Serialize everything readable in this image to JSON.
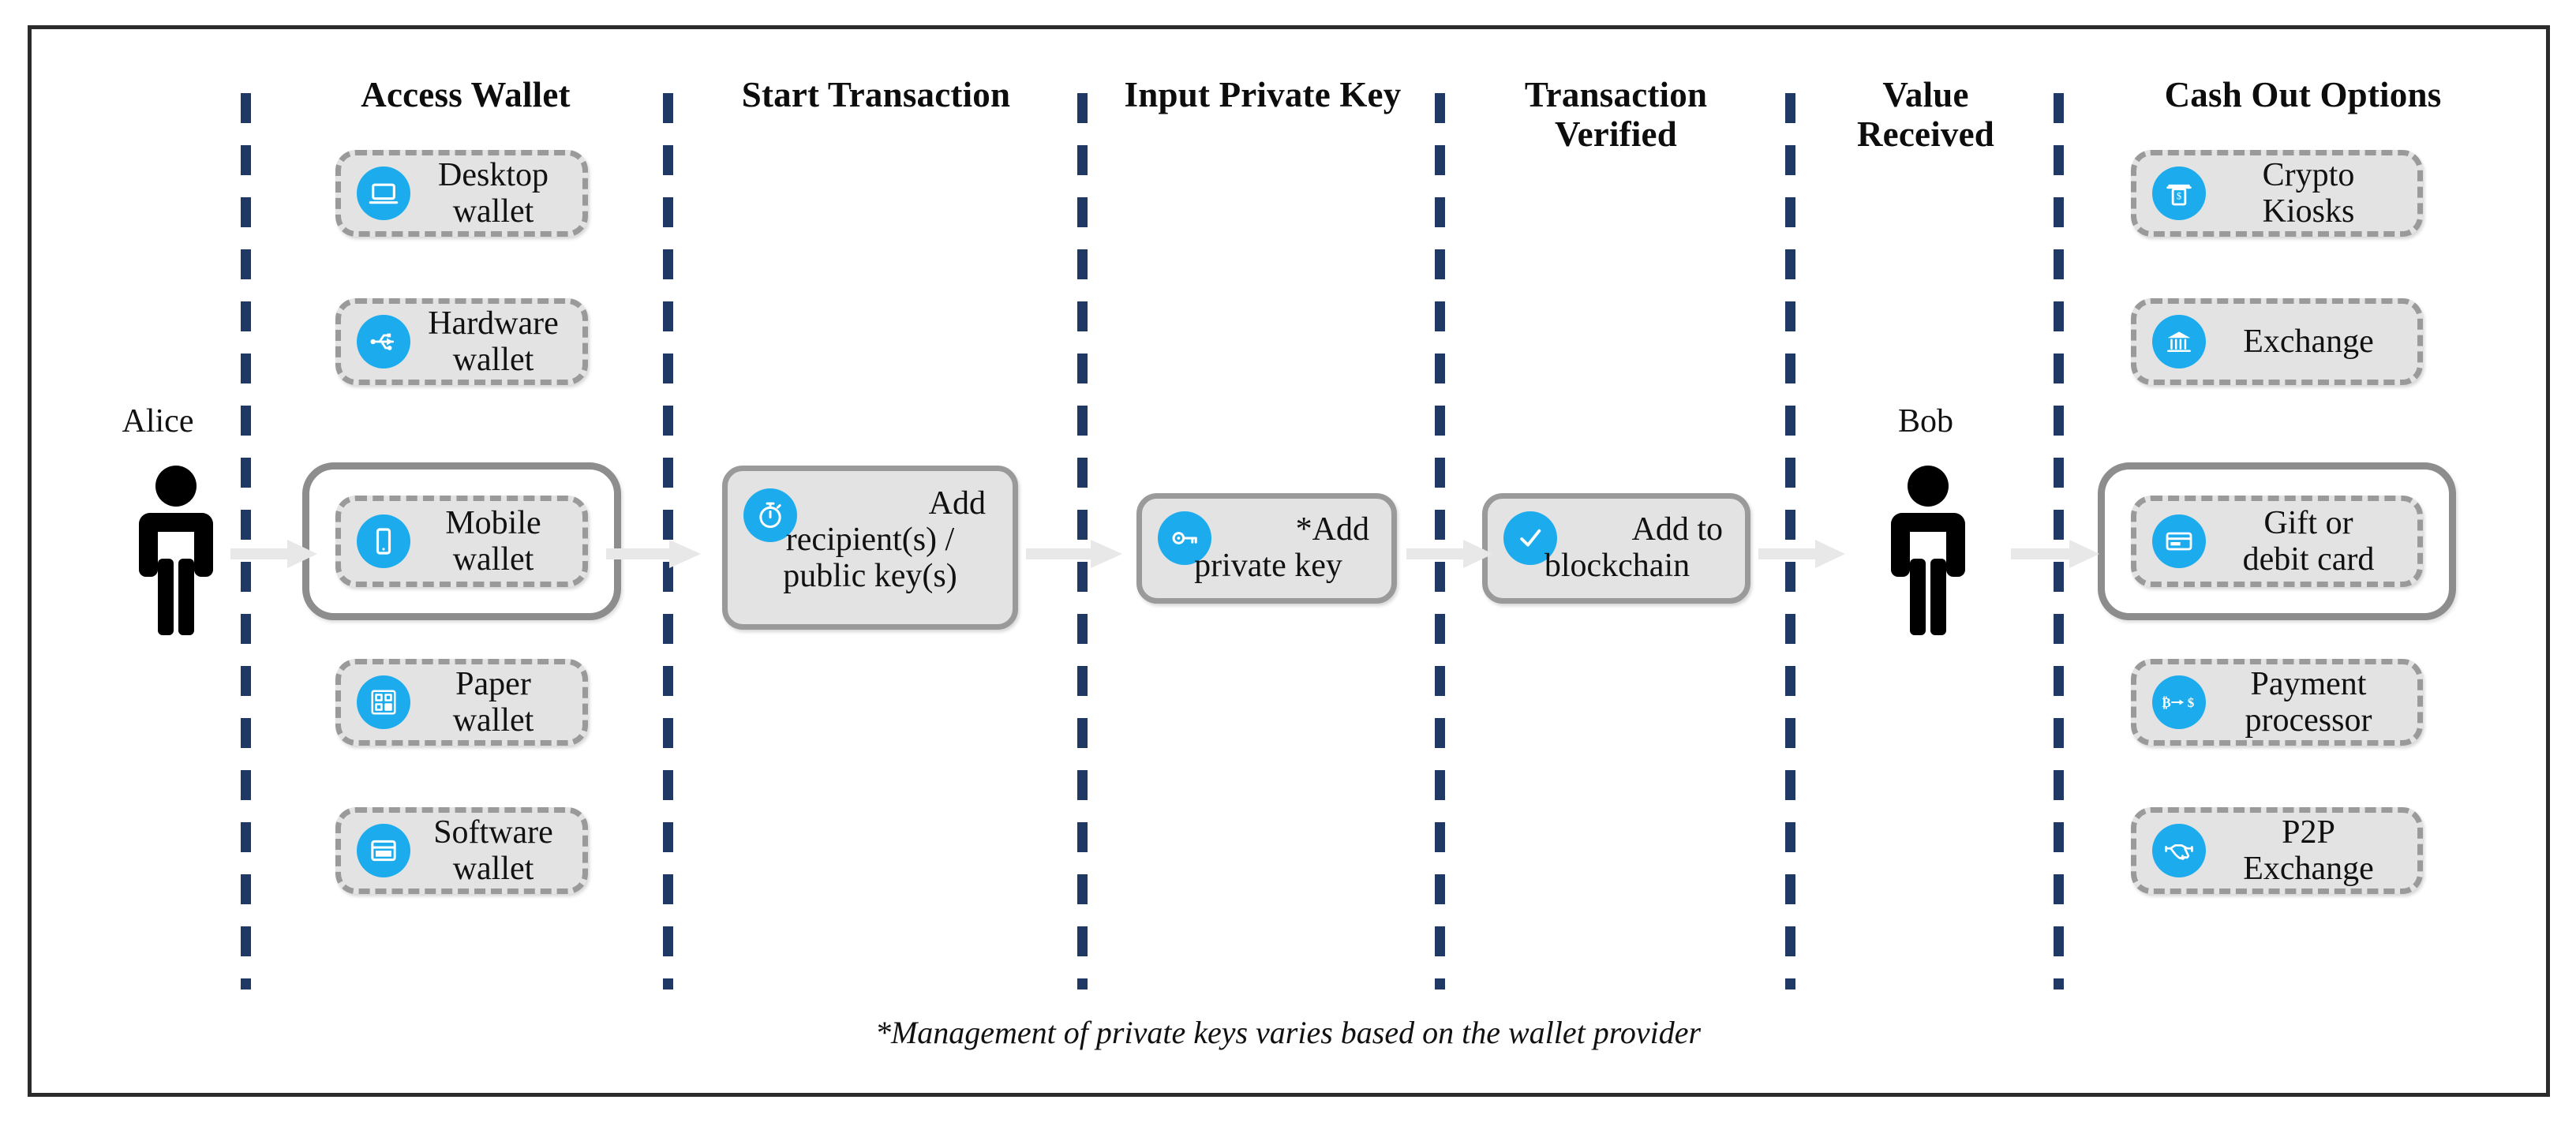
{
  "diagram": {
    "footnote": "*Management of private keys varies based on the wallet provider",
    "accent_color": "#1CACEE",
    "divider_color": "#1F3864",
    "box_fill": "#E3E3E3",
    "box_border": "#9A9A9A",
    "arrow_color": "#E8E8E8"
  },
  "columns": [
    {
      "id": "access-wallet",
      "title": "Access Wallet"
    },
    {
      "id": "start-transaction",
      "title": "Start Transaction"
    },
    {
      "id": "input-private-key",
      "title": "Input Private Key"
    },
    {
      "id": "transaction-verified",
      "title": "Transaction\nVerified",
      "line1": "Transaction",
      "line2": "Verified"
    },
    {
      "id": "value-received",
      "title": "Value\nReceived",
      "line1": "Value",
      "line2": "Received"
    },
    {
      "id": "cash-out-options",
      "title": "Cash Out Options"
    }
  ],
  "actors": {
    "sender": {
      "name": "Alice",
      "icon": "person-icon"
    },
    "receiver": {
      "name": "Bob",
      "icon": "person-icon"
    }
  },
  "wallets": [
    {
      "id": "desktop-wallet",
      "line1": "Desktop",
      "line2": "wallet",
      "icon": "laptop-icon",
      "highlighted": false
    },
    {
      "id": "hardware-wallet",
      "line1": "Hardware",
      "line2": "wallet",
      "icon": "usb-icon",
      "highlighted": false
    },
    {
      "id": "mobile-wallet",
      "line1": "Mobile",
      "line2": "wallet",
      "icon": "smartphone-icon",
      "highlighted": true
    },
    {
      "id": "paper-wallet",
      "line1": "Paper",
      "line2": "wallet",
      "icon": "qr-code-icon",
      "highlighted": false
    },
    {
      "id": "software-wallet",
      "line1": "Software",
      "line2": "wallet",
      "icon": "window-icon",
      "highlighted": false
    }
  ],
  "steps": [
    {
      "id": "add-recipient",
      "line1": "Add",
      "line2": "recipient(s) /",
      "line3": "public key(s)",
      "icon": "stopwatch-icon"
    },
    {
      "id": "add-private-key",
      "line1": "*Add",
      "line2": "private key",
      "icon": "key-icon"
    },
    {
      "id": "add-to-blockchain",
      "line1": "Add to",
      "line2": "blockchain",
      "icon": "check-circle-icon"
    }
  ],
  "cash_out_options": [
    {
      "id": "crypto-kiosks",
      "line1": "Crypto",
      "line2": "Kiosks",
      "icon": "atm-icon",
      "highlighted": false
    },
    {
      "id": "exchange",
      "line1": "Exchange",
      "line2": "",
      "icon": "bank-icon",
      "highlighted": false
    },
    {
      "id": "gift-or-debit-card",
      "line1": "Gift or",
      "line2": "debit card",
      "icon": "credit-card-icon",
      "highlighted": true
    },
    {
      "id": "payment-processor",
      "line1": "Payment",
      "line2": "processor",
      "icon": "btc-to-usd-icon",
      "highlighted": false
    },
    {
      "id": "p2p-exchange",
      "line1": "P2P",
      "line2": "Exchange",
      "icon": "handshake-icon",
      "highlighted": false
    }
  ],
  "flow_arrows": [
    {
      "id": "alice-to-wallet"
    },
    {
      "id": "wallet-to-start"
    },
    {
      "id": "start-to-key"
    },
    {
      "id": "key-to-blockchain"
    },
    {
      "id": "blockchain-to-bob"
    },
    {
      "id": "bob-to-cashout"
    }
  ]
}
